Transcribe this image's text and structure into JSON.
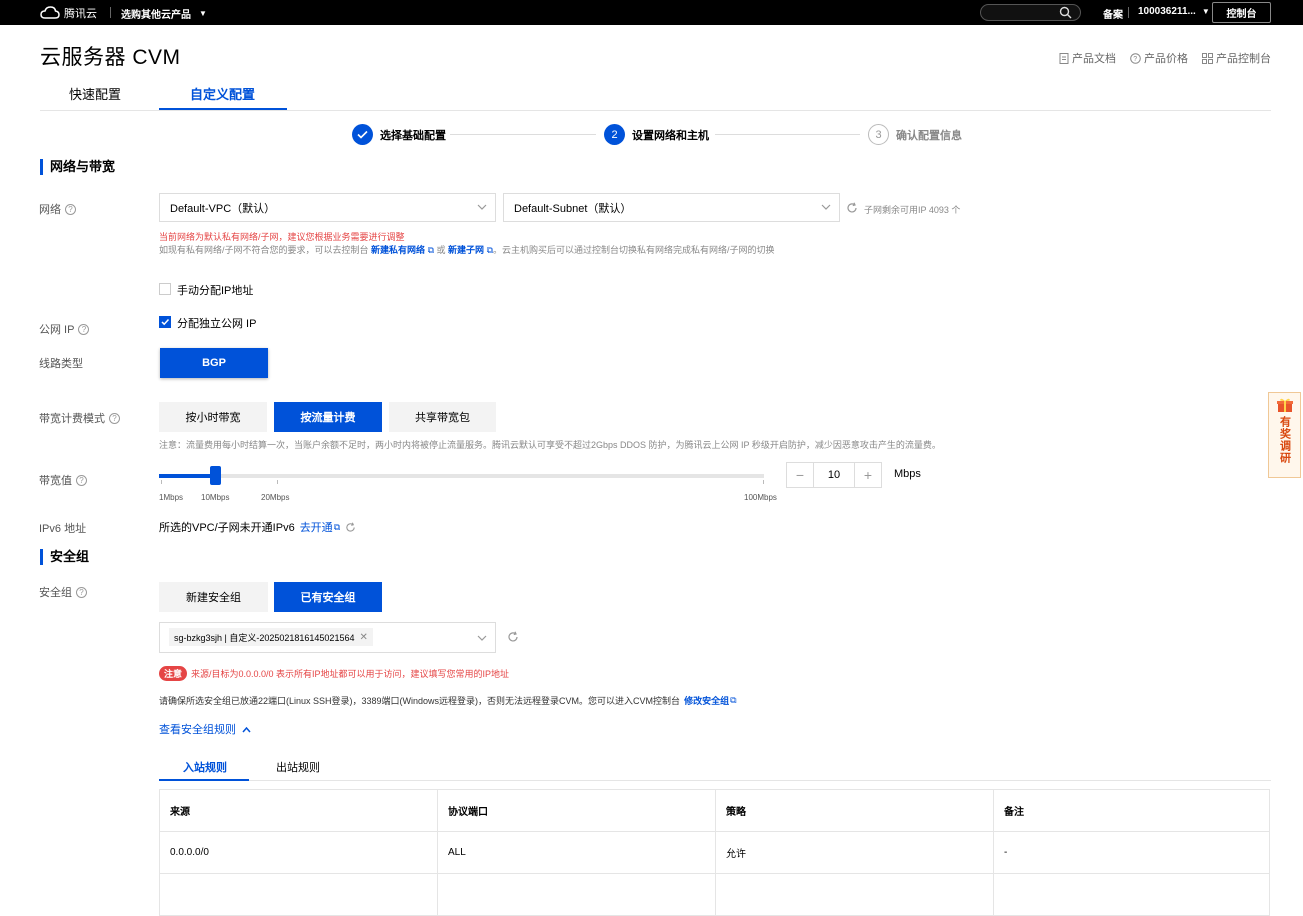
{
  "topbar": {
    "logo_text": "腾讯云",
    "products_label": "选购其他云产品",
    "beian_label": "备案",
    "account_label": "100036211...",
    "console_label": "控制台"
  },
  "header": {
    "title": "云服务器 CVM",
    "links": [
      "产品文档",
      "产品价格",
      "产品控制台"
    ]
  },
  "config_tabs": [
    "快速配置",
    "自定义配置"
  ],
  "steps": [
    {
      "num": "",
      "label": "选择基础配置"
    },
    {
      "num": "2",
      "label": "设置网络和主机"
    },
    {
      "num": "3",
      "label": "确认配置信息"
    }
  ],
  "network_section": {
    "title": "网络与带宽",
    "network_label": "网络",
    "vpc_value": "Default-VPC（默认）",
    "subnet_value": "Default-Subnet（默认）",
    "subnet_remaining": "子网剩余可用IP 4093 个",
    "red_notice": "当前网络为默认私有网络/子网，建议您根据业务需要进行调整",
    "help_prefix": "如现有私有网络/子网不符合您的要求，可以去控制台",
    "help_link1": "新建私有网络",
    "help_or": "或",
    "help_link2": "新建子网",
    "help_suffix": "。云主机购买后可以通过控制台切换私有网络完成私有网络/子网的切换",
    "manual_ip_label": "手动分配IP地址",
    "public_ip_label": "公网 IP",
    "public_ip_checkbox": "分配独立公网 IP",
    "line_type_label": "线路类型",
    "line_type_value": "BGP",
    "billing_label": "带宽计费模式",
    "billing_options": [
      "按小时带宽",
      "按流量计费",
      "共享带宽包"
    ],
    "billing_note": "注意：流量费用每小时结算一次，当账户余额不足时，两小时内将被停止流量服务。腾讯云默认可享受不超过2Gbps DDOS 防护，为腾讯云上公网 IP 秒级开启防护，减少因恶意攻击产生的流量费。",
    "bandwidth_label": "带宽值",
    "bandwidth_value": "10",
    "bandwidth_max": 100,
    "bandwidth_unit": "Mbps",
    "tick_labels": [
      "1Mbps",
      "10Mbps",
      "20Mbps",
      "100Mbps"
    ],
    "ipv6_label": "IPv6 地址",
    "ipv6_text": "所选的VPC/子网未开通IPv6",
    "ipv6_link": "去开通"
  },
  "security_section": {
    "title": "安全组",
    "sg_label": "安全组",
    "sg_options": [
      "新建安全组",
      "已有安全组"
    ],
    "selected_tag": "sg-bzkg3sjh | 自定义-20250218161450215​64",
    "note_badge": "注意",
    "note_text": "来源/目标为0.0.0.0/0 表示所有IP地址都可以用于访问，建议填写您常用的IP地址",
    "ports_text": "请确保所选安全组已放通22端口(Linux SSH登录)，3389端口(Windows远程登录)，否则无法远程登录CVM。您可以进入CVM控制台",
    "ports_link": "修改安全组",
    "view_rules": "查看安全组规则",
    "rule_tabs": [
      "入站规则",
      "出站规则"
    ],
    "table_headers": [
      "来源",
      "协议端口",
      "策略",
      "备注"
    ],
    "table_rows": [
      [
        "0.0.0.0/0",
        "ALL",
        "允许",
        "-"
      ]
    ]
  },
  "float_survey": {
    "text": "有奖调研"
  }
}
